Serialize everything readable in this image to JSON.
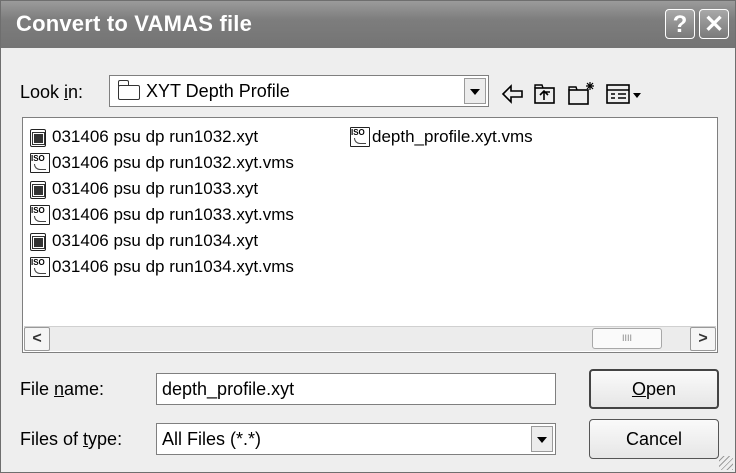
{
  "window": {
    "title": "Convert to VAMAS file",
    "help_glyph": "?",
    "close_glyph": "✕"
  },
  "look_in": {
    "label_prefix": "Look ",
    "label_accel": "i",
    "label_suffix": "n:",
    "value": "XYT Depth Profile"
  },
  "toolbar": {
    "icons": [
      "back-arrow-icon",
      "up-folder-icon",
      "new-folder-icon",
      "view-menu-icon"
    ]
  },
  "files": [
    {
      "name": "031406 psu dp run1032.xyt",
      "type": "xyt"
    },
    {
      "name": "031406 psu dp run1032.xyt.vms",
      "type": "vms"
    },
    {
      "name": "031406 psu dp run1033.xyt",
      "type": "xyt"
    },
    {
      "name": "031406 psu dp run1033.xyt.vms",
      "type": "vms"
    },
    {
      "name": "031406 psu dp run1034.xyt",
      "type": "xyt"
    },
    {
      "name": "031406 psu dp run1034.xyt.vms",
      "type": "vms"
    },
    {
      "name": "depth_profile.xyt.vms",
      "type": "vms"
    }
  ],
  "file_name": {
    "label_prefix": "File ",
    "label_accel": "n",
    "label_suffix": "ame:",
    "value": "depth_profile.xyt"
  },
  "file_type": {
    "label_prefix": "Files of ",
    "label_accel": "t",
    "label_suffix": "ype:",
    "value": "All Files (*.*)"
  },
  "buttons": {
    "open_accel": "O",
    "open_rest": "pen",
    "cancel": "Cancel"
  },
  "scrollbar": {
    "left": "<",
    "right": ">",
    "grip": "IIII"
  },
  "colors": {
    "titlebar": "#7d7d7d",
    "dialog_bg": "#eeeeee"
  }
}
